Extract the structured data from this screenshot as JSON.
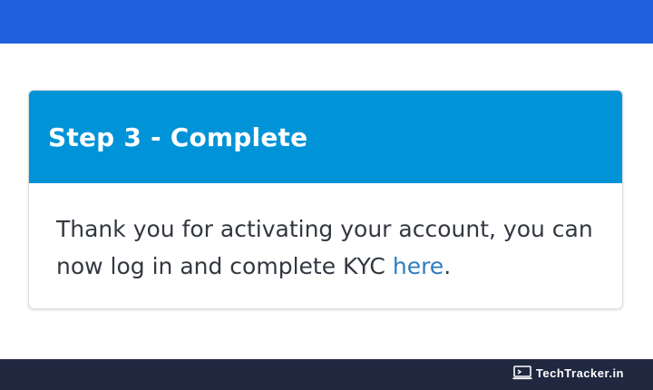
{
  "colors": {
    "top_bar": "#1f5fdc",
    "card_header": "#0193d7",
    "link": "#2f7dc0",
    "footer": "#202840"
  },
  "card": {
    "title": "Step 3 - Complete",
    "message_before_link": "Thank you for activating your account, you can now log in and complete KYC ",
    "link_text": "here",
    "message_after_link": "."
  },
  "watermark": {
    "icon": "laptop-icon",
    "text": "TechTracker.in"
  }
}
